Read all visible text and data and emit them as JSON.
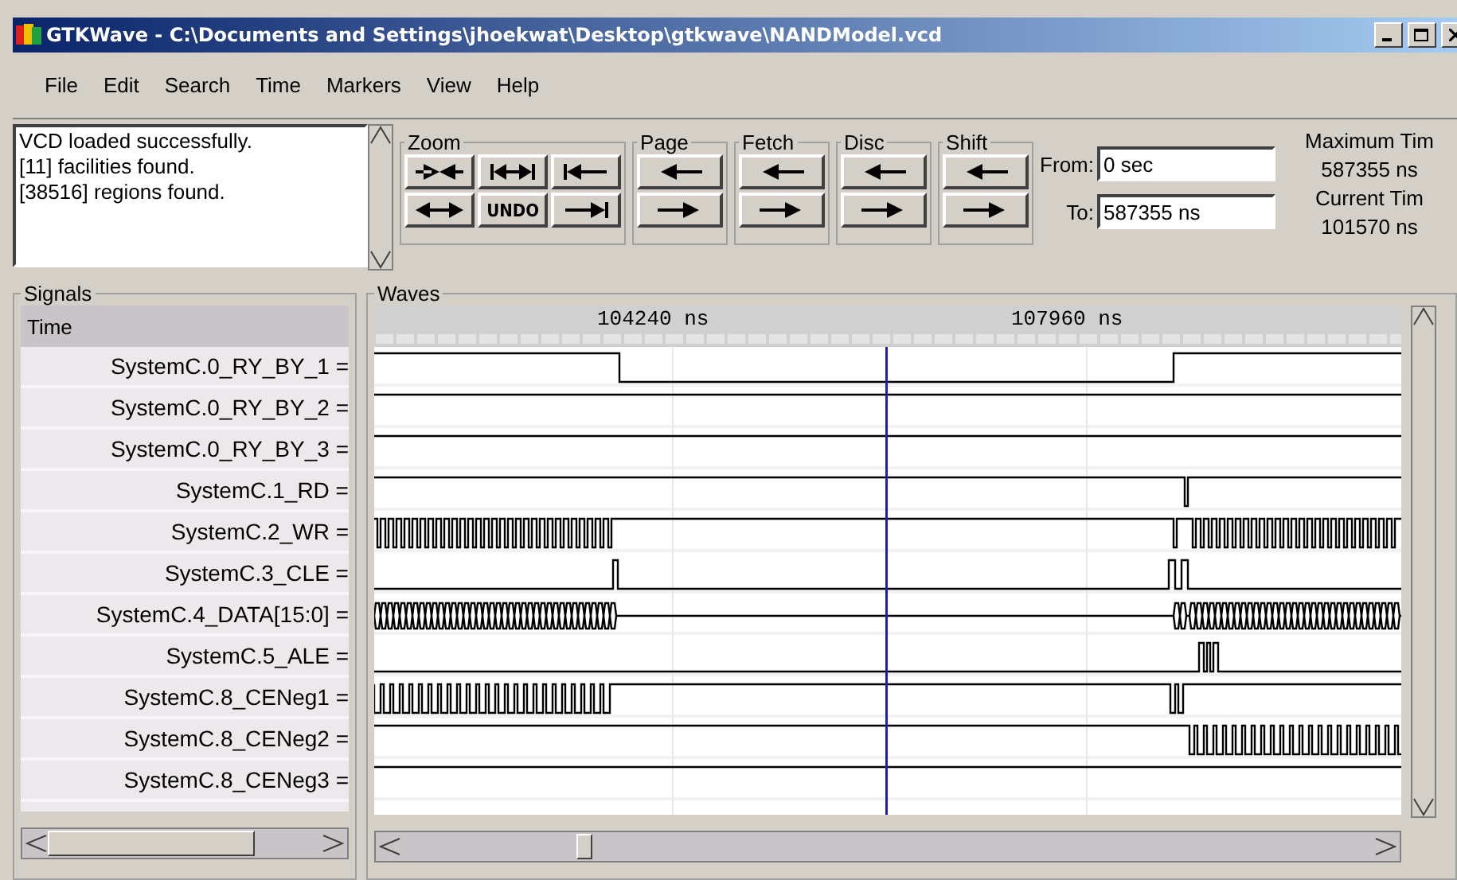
{
  "window": {
    "title": "GTKWave - C:\\Documents and Settings\\jhoekwat\\Desktop\\gtkwave\\NANDModel.vcd"
  },
  "menu": [
    "File",
    "Edit",
    "Search",
    "Time",
    "Markers",
    "View",
    "Help"
  ],
  "log": [
    "VCD loaded successfully.",
    "[11] facilities found.",
    "[38516] regions found."
  ],
  "toolbar_groups": [
    {
      "label": "Zoom",
      "buttons": [
        {
          "kind": "converge"
        },
        {
          "kind": "span"
        },
        {
          "kind": "to-start"
        },
        {
          "kind": "expand"
        },
        {
          "kind": "text",
          "label": "UNDO"
        },
        {
          "kind": "to-end"
        }
      ]
    },
    {
      "label": "Page",
      "buttons": [
        {
          "kind": "left"
        },
        {
          "kind": "right"
        }
      ]
    },
    {
      "label": "Fetch",
      "buttons": [
        {
          "kind": "left"
        },
        {
          "kind": "right"
        }
      ]
    },
    {
      "label": "Disc",
      "buttons": [
        {
          "kind": "left"
        },
        {
          "kind": "right"
        }
      ]
    },
    {
      "label": "Shift",
      "buttons": [
        {
          "kind": "left"
        },
        {
          "kind": "right"
        }
      ]
    }
  ],
  "range": {
    "from_label": "From:",
    "from_value": "0 sec",
    "to_label": "To:",
    "to_value": "587355 ns"
  },
  "times": [
    "Maximum Tim",
    "587355 ns",
    "Current Tim",
    "101570 ns"
  ],
  "signals": {
    "title": "Signals",
    "header": "Time",
    "rows": [
      "SystemC.0_RY_BY_1 =",
      "SystemC.0_RY_BY_2 =",
      "SystemC.0_RY_BY_3 =",
      "SystemC.1_RD =",
      "SystemC.2_WR =",
      "SystemC.3_CLE =",
      "SystemC.4_DATA[15:0] =",
      "SystemC.5_ALE =",
      "SystemC.8_CENeg1 =",
      "SystemC.8_CENeg2 =",
      "SystemC.8_CENeg3 ="
    ]
  },
  "waves": {
    "title": "Waves",
    "ruler": [
      "104240 ns",
      "107960 ns"
    ]
  }
}
